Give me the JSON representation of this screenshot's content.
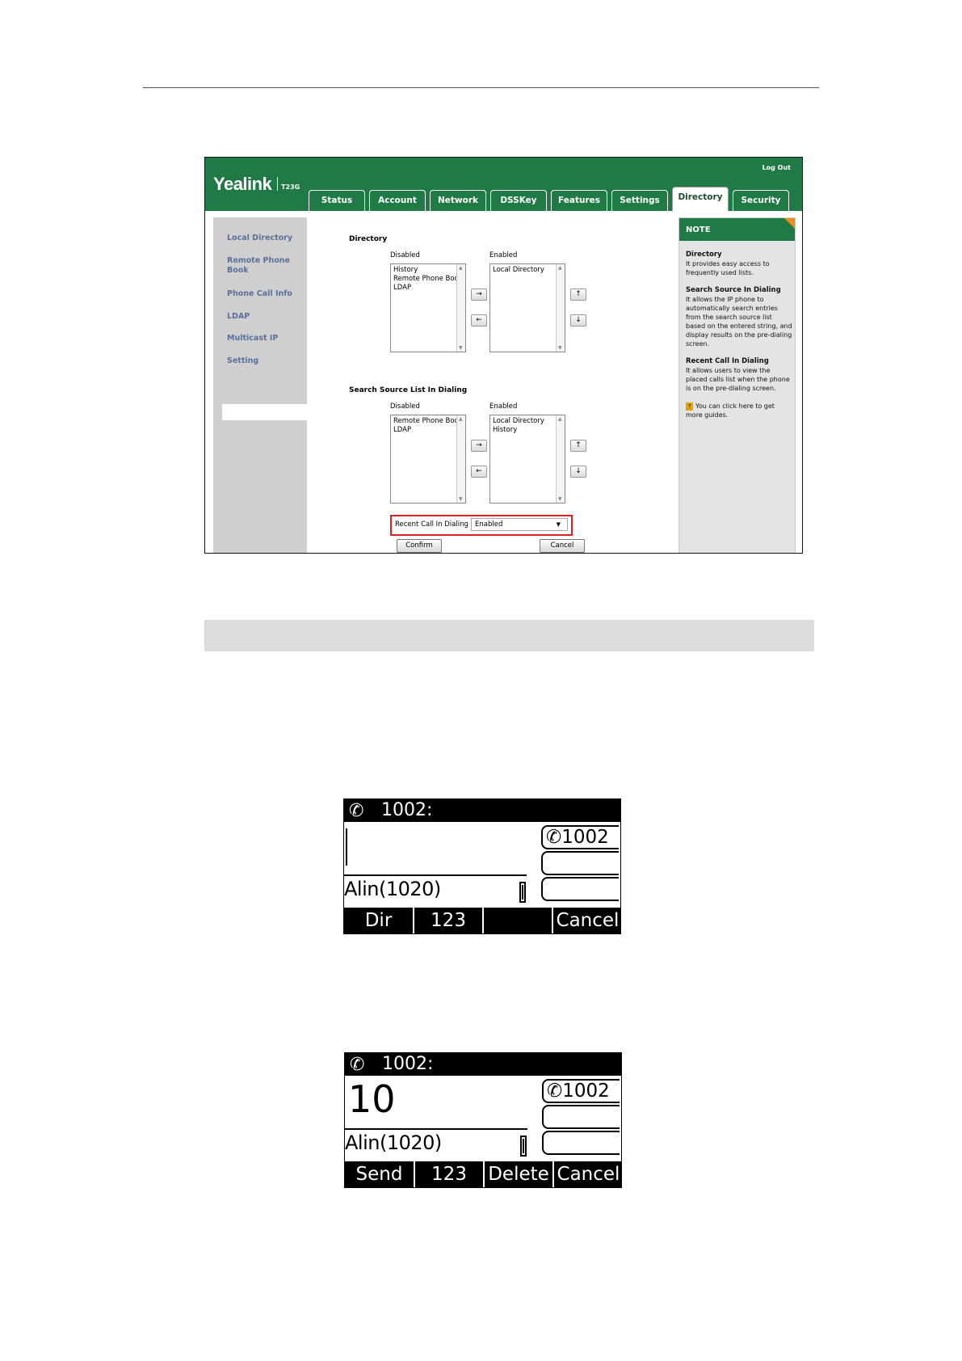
{
  "webui": {
    "brand": "Yealink",
    "model": "T23G",
    "logout": "Log Out",
    "tabs": [
      "Status",
      "Account",
      "Network",
      "DSSKey",
      "Features",
      "Settings",
      "Directory",
      "Security"
    ],
    "active_tab": "Directory",
    "sidebar": [
      "Local Directory",
      "Remote Phone Book",
      "Phone Call Info",
      "LDAP",
      "Multicast IP",
      "Setting"
    ],
    "active_sidebar": "Setting",
    "directory": {
      "title": "Directory",
      "disabled_label": "Disabled",
      "enabled_label": "Enabled",
      "disabled_items": [
        "History",
        "Remote Phone Boo",
        "LDAP"
      ],
      "enabled_items": [
        "Local Directory"
      ]
    },
    "search_source": {
      "title": "Search Source List In Dialing",
      "disabled_label": "Disabled",
      "enabled_label": "Enabled",
      "disabled_items": [
        "Remote Phone Boo",
        "LDAP"
      ],
      "enabled_items": [
        "Local Directory",
        "History"
      ]
    },
    "move_right": "→",
    "move_left": "←",
    "move_up": "↑",
    "move_down": "↓",
    "recent_call_label": "Recent Call In Dialing",
    "recent_call_value": "Enabled",
    "confirm": "Confirm",
    "cancel": "Cancel",
    "note": {
      "header": "NOTE",
      "sections": [
        {
          "title": "Directory",
          "text": "It provides easy access to frequently used lists."
        },
        {
          "title": "Search Source In Dialing",
          "text": "It allows the IP phone to automatically search entries from the search source list based on the entered string, and display results on the pre-dialing screen."
        },
        {
          "title": "Recent Call In Dialing",
          "text": "It allows users to view the placed calls list when the phone is on the pre-dialing screen."
        }
      ],
      "help_icon": "?",
      "help_text": "You can click here to get more guides."
    }
  },
  "phone1": {
    "account": "1002:",
    "input": "",
    "match": "Alin(1020)",
    "line_key": "1002",
    "softkeys": [
      "Dir",
      "123",
      "",
      "Cancel"
    ]
  },
  "phone2": {
    "account": "1002:",
    "input": "10",
    "match": "Alin(1020)",
    "line_key": "1002",
    "softkeys": [
      "Send",
      "123",
      "Delete",
      "Cancel"
    ]
  },
  "colors": {
    "header_green": "#1f7a45",
    "highlight_red": "#dd2222",
    "note_corner": "#f08a1c"
  }
}
